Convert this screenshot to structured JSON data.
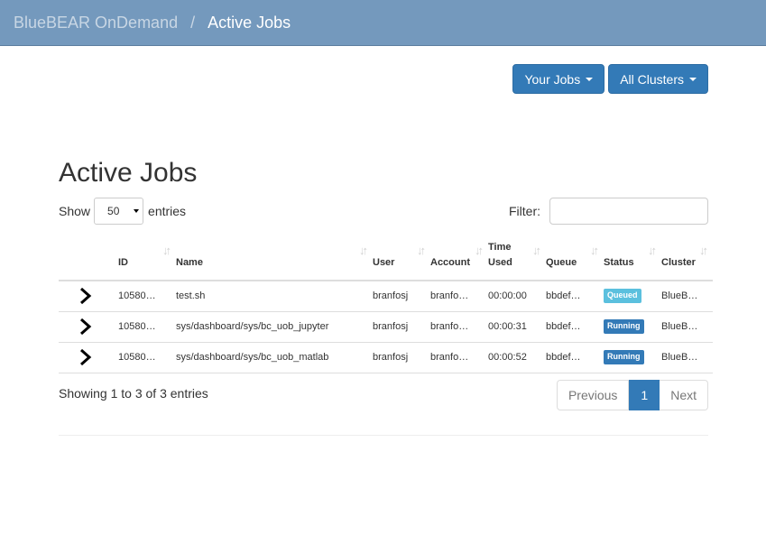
{
  "navbar": {
    "brand": "BlueBEAR OnDemand",
    "separator": "/",
    "current": "Active Jobs"
  },
  "toolbar": {
    "your_jobs_label": "Your Jobs",
    "all_clusters_label": "All Clusters"
  },
  "page": {
    "title": "Active Jobs"
  },
  "length": {
    "show_label": "Show",
    "selected": "50",
    "entries_label": "entries"
  },
  "filter": {
    "label": "Filter:",
    "value": ""
  },
  "table": {
    "headers": {
      "id": "ID",
      "name": "Name",
      "user": "User",
      "account": "Account",
      "time_used_1": "Time",
      "time_used_2": "Used",
      "queue": "Queue",
      "status": "Status",
      "cluster": "Cluster"
    },
    "rows": [
      {
        "id": "10580…",
        "name": "test.sh",
        "user": "branfosj",
        "account": "branfo…",
        "time_used": "00:00:00",
        "queue": "bbdef…",
        "status": "Queued",
        "cluster": "BlueB…"
      },
      {
        "id": "10580…",
        "name": "sys/dashboard/sys/bc_uob_jupyter",
        "user": "branfosj",
        "account": "branfo…",
        "time_used": "00:00:31",
        "queue": "bbdef…",
        "status": "Running",
        "cluster": "BlueB…"
      },
      {
        "id": "10580…",
        "name": "sys/dashboard/sys/bc_uob_matlab",
        "user": "branfosj",
        "account": "branfo…",
        "time_used": "00:00:52",
        "queue": "bbdef…",
        "status": "Running",
        "cluster": "BlueB…"
      }
    ]
  },
  "info": "Showing 1 to 3 of 3 entries",
  "pagination": {
    "previous": "Previous",
    "current": "1",
    "next": "Next"
  },
  "colors": {
    "navbar": "#7499bd",
    "primary": "#337ab7",
    "queued": "#5bc0de",
    "running": "#337ab7"
  }
}
